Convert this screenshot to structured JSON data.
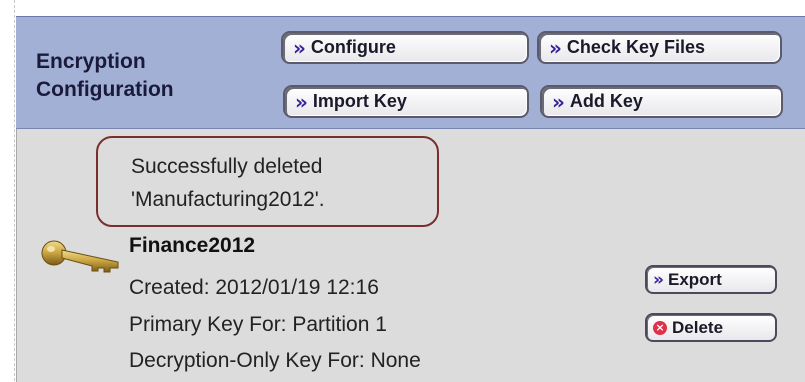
{
  "header": {
    "title_line1": "Encryption",
    "title_line2": "Configuration",
    "buttons": {
      "configure": "Configure",
      "check_key_files": "Check Key Files",
      "import_key": "Import Key",
      "add_key": "Add Key"
    }
  },
  "message": {
    "line1": "Successfully deleted",
    "line2": "'Manufacturing2012'."
  },
  "key": {
    "name": "Finance2012",
    "created": "Created: 2012/01/19 12:16",
    "primary": "Primary Key For: Partition 1",
    "decryption_only": "Decryption-Only Key For: None",
    "export_label": "Export",
    "delete_label": "Delete"
  },
  "colors": {
    "header_bg": "#a3b0d6",
    "panel_bg": "#dcdcdc",
    "message_border": "#7a2e2e",
    "chevron": "#3a1f9a",
    "delete_icon": "#e0304a"
  },
  "icons": {
    "chevron": "double-chevron-right-icon",
    "key": "key-icon",
    "delete": "delete-x-icon"
  }
}
